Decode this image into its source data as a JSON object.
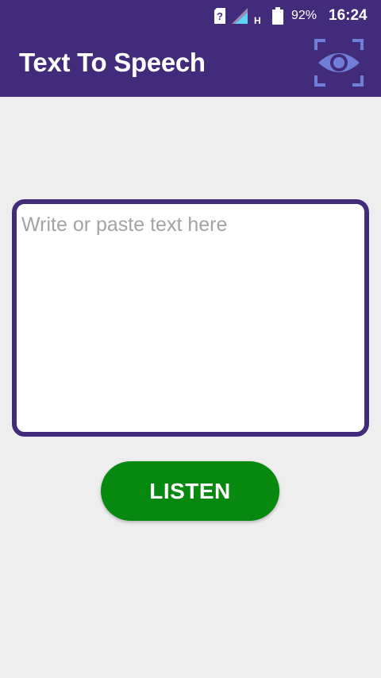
{
  "status_bar": {
    "network_type": "H",
    "battery": "92%",
    "time": "16:24"
  },
  "app_bar": {
    "title": "Text To Speech",
    "scan_icon": "eye-scan-icon"
  },
  "editor": {
    "placeholder": "Write or paste text here",
    "value": ""
  },
  "actions": {
    "listen_label": "LISTEN"
  },
  "colors": {
    "primary": "#432b7b",
    "accent_icon": "#6f7fd8",
    "button": "#07880f",
    "background": "#eeeeee"
  }
}
